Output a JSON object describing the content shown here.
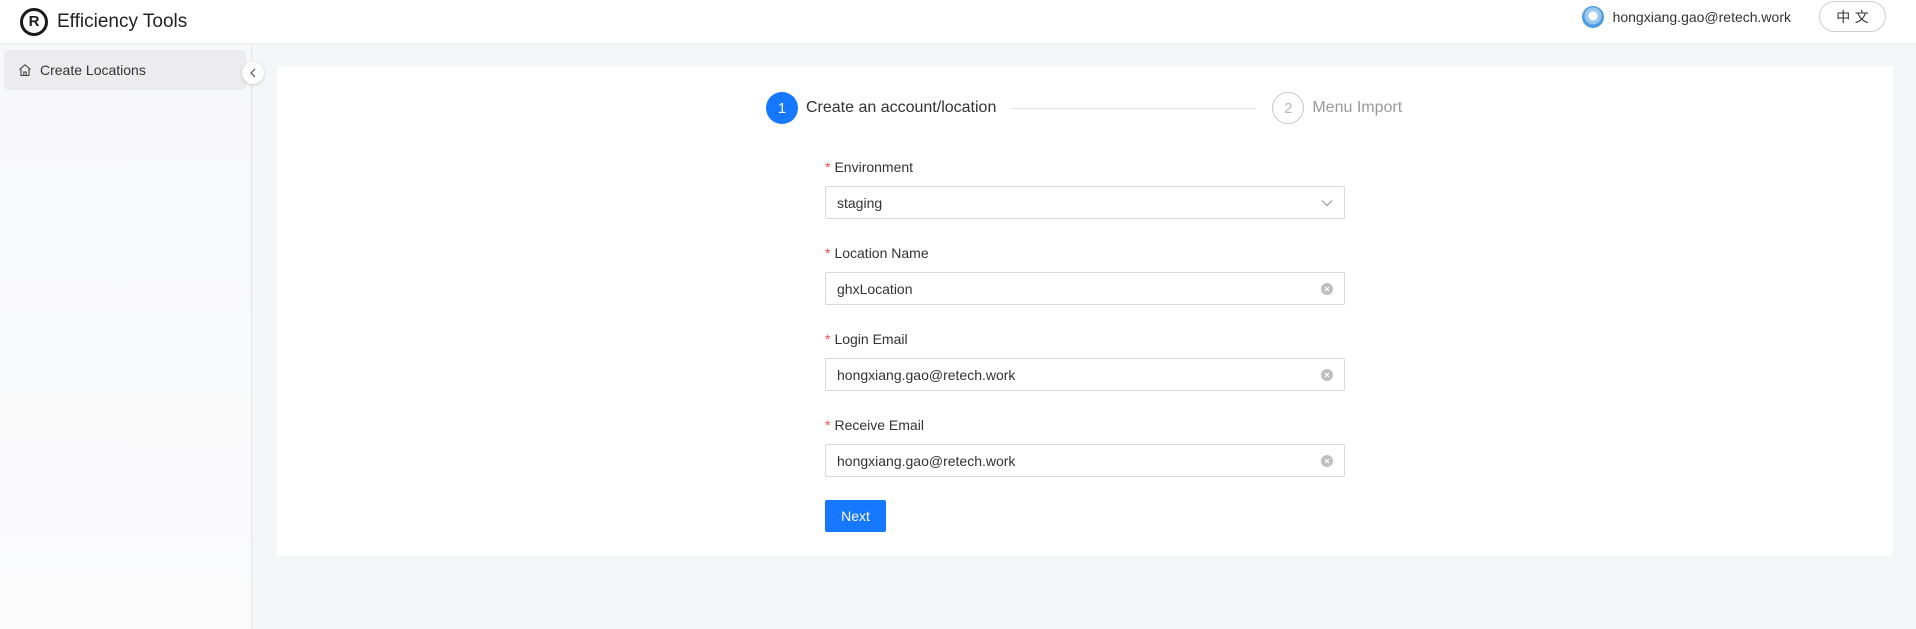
{
  "header": {
    "app_title": "Efficiency Tools",
    "logo_icon": "registered-logo-icon",
    "user_email": "hongxiang.gao@retech.work",
    "language_toggle": "中 文"
  },
  "sidebar": {
    "items": [
      {
        "label": "Create Locations",
        "icon": "home-icon"
      }
    ],
    "collapse_icon": "chevron-left-icon"
  },
  "steps": [
    {
      "number": "1",
      "label": "Create an account/location",
      "status": "active"
    },
    {
      "number": "2",
      "label": "Menu Import",
      "status": "pending"
    }
  ],
  "form": {
    "environment": {
      "label": "Environment",
      "value": "staging"
    },
    "location_name": {
      "label": "Location Name",
      "value": "ghxLocation"
    },
    "login_email": {
      "label": "Login Email",
      "value": "hongxiang.gao@retech.work"
    },
    "receive_email": {
      "label": "Receive Email",
      "value": "hongxiang.gao@retech.work"
    },
    "required_marker": "*",
    "next_label": "Next"
  },
  "colors": {
    "primary": "#1677ff",
    "required": "#ff4d4f"
  }
}
